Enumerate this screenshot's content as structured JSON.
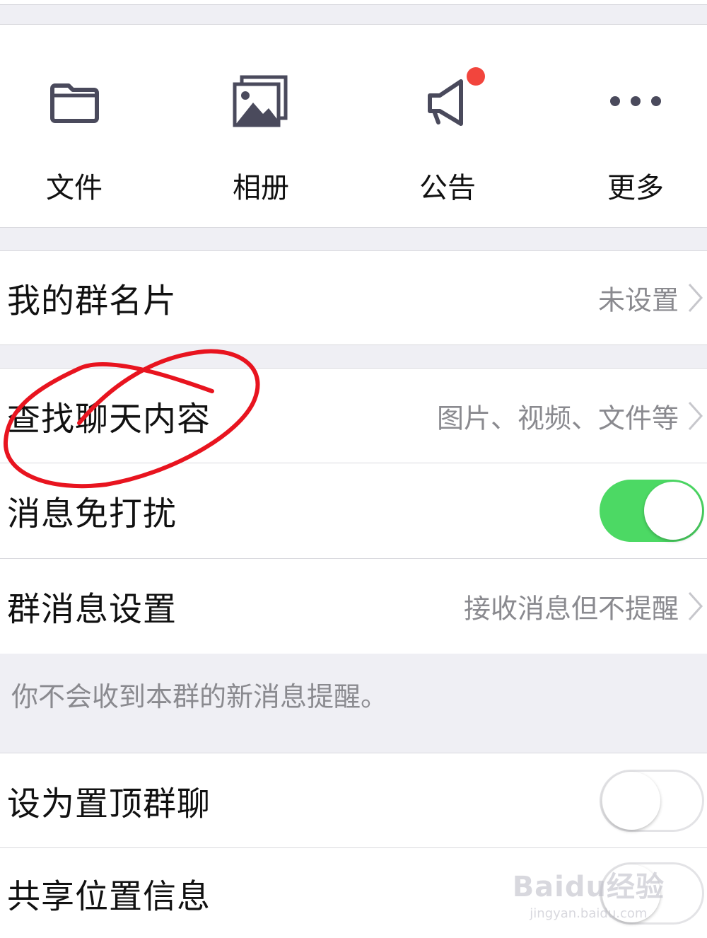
{
  "toolbar": {
    "items": [
      {
        "label": "文件",
        "icon": "folder-icon"
      },
      {
        "label": "相册",
        "icon": "photo-album-icon"
      },
      {
        "label": "公告",
        "icon": "megaphone-icon"
      },
      {
        "label": "更多",
        "icon": "more-dots-icon"
      }
    ]
  },
  "rows": {
    "group_card": {
      "title": "我的群名片",
      "value": "未设置"
    },
    "search_chat": {
      "title": "查找聊天内容",
      "value": "图片、视频、文件等"
    },
    "mute": {
      "title": "消息免打扰",
      "toggle_on": true
    },
    "group_msg_settings": {
      "title": "群消息设置",
      "value": "接收消息但不提醒"
    },
    "pin_chat": {
      "title": "设为置顶群聊",
      "toggle_on": false
    },
    "share_location": {
      "title": "共享位置信息",
      "toggle_on": false
    }
  },
  "note": "你不会收到本群的新消息提醒。",
  "watermark": {
    "line1": "Baidu经验",
    "line2": "jingyan.baidu.com"
  },
  "colors": {
    "toggle_on": "#4cd964",
    "badge": "#f2453d",
    "annotation": "#e8141f",
    "icon": "#4a4a5c"
  }
}
